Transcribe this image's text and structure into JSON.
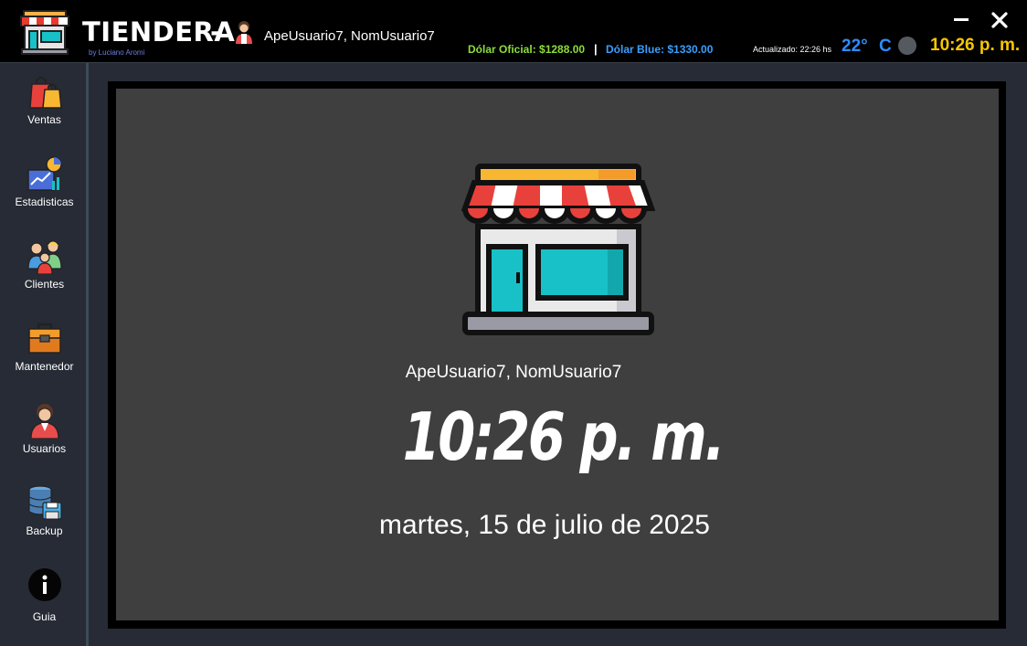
{
  "header": {
    "app_title": "TIENDERA",
    "dash": "-",
    "byline": "by Luciano Aromi",
    "user": "ApeUsuario7, NomUsuario7",
    "dolar_oficial": "Dólar Oficial: $1288.00",
    "separator": "|",
    "dolar_blue": "Dólar Blue: $1330.00",
    "actualizado": "Actualizado: 22:26 hs",
    "temperature": "22°",
    "temperature_unit": "C",
    "clock": "10:26 p. m."
  },
  "sidebar": {
    "items": [
      {
        "label": "Ventas",
        "icon": "shopping-bags-icon"
      },
      {
        "label": "Estadisticas",
        "icon": "statistics-icon"
      },
      {
        "label": "Clientes",
        "icon": "customers-icon"
      },
      {
        "label": "Mantenedor",
        "icon": "toolbox-icon"
      },
      {
        "label": "Usuarios",
        "icon": "user-icon"
      },
      {
        "label": "Backup",
        "icon": "database-backup-icon"
      },
      {
        "label": "Guia",
        "icon": "info-icon"
      }
    ]
  },
  "main": {
    "user": "ApeUsuario7, NomUsuario7",
    "clock": "10:26 p. m.",
    "date": "martes, 15 de julio de 2025"
  },
  "colors": {
    "dolar_oficial": "#8ddd3a",
    "dolar_blue": "#3aa0ff",
    "clock_accent": "#f7c600",
    "temperature": "#2f8cff"
  }
}
